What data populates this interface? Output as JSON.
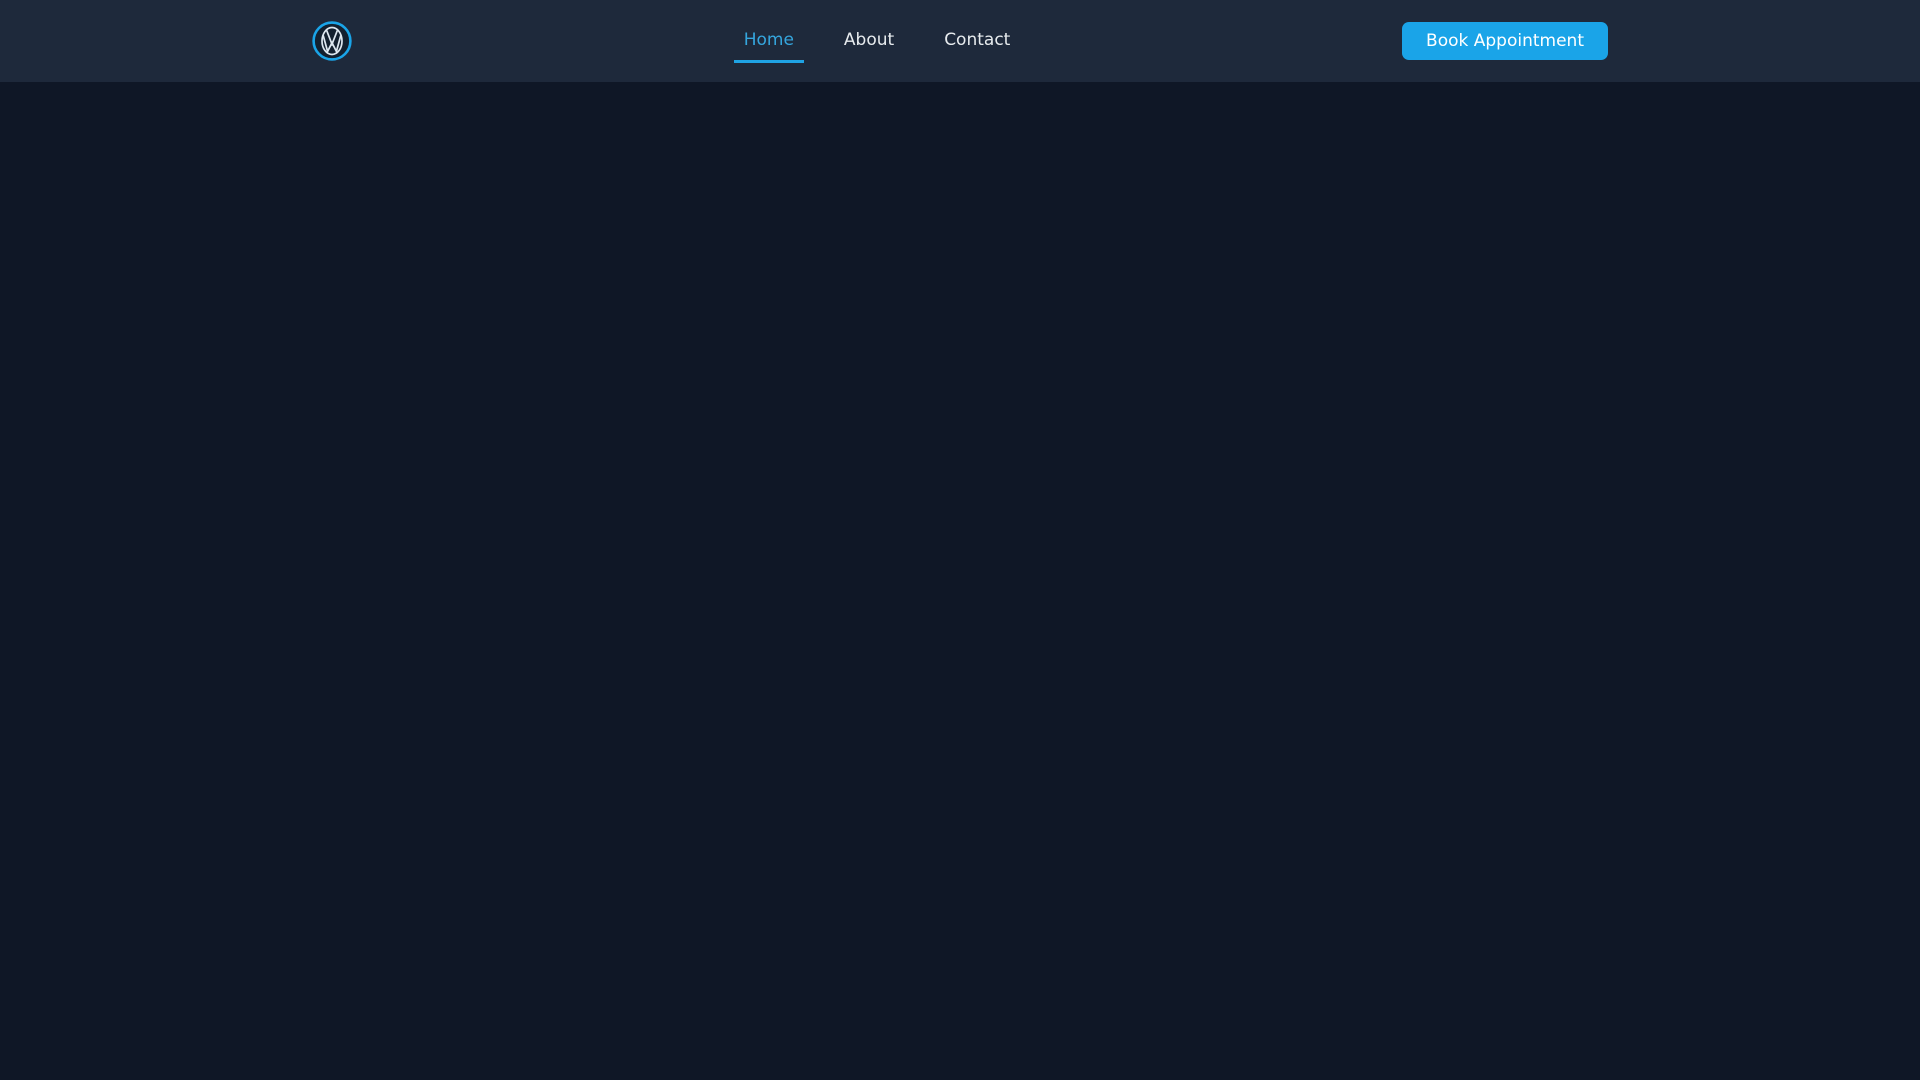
{
  "theme": {
    "page_bg": "#0f1726",
    "navbar_bg": "#1e293b",
    "accent": "#1aa4e8",
    "active_link_color": "#35a6de",
    "link_color": "#e7ebee",
    "button_text_color": "#ffffff",
    "logo_ring_color": "#1aa4e8",
    "logo_inner_color": "#13202f",
    "logo_emblem_color": "#dde7f0"
  },
  "navbar": {
    "logo": {
      "icon": "vw-roundel-icon"
    },
    "links": [
      {
        "label": "Home",
        "active": true
      },
      {
        "label": "About",
        "active": false
      },
      {
        "label": "Contact",
        "active": false
      }
    ],
    "cta_label": "Book Appointment"
  }
}
